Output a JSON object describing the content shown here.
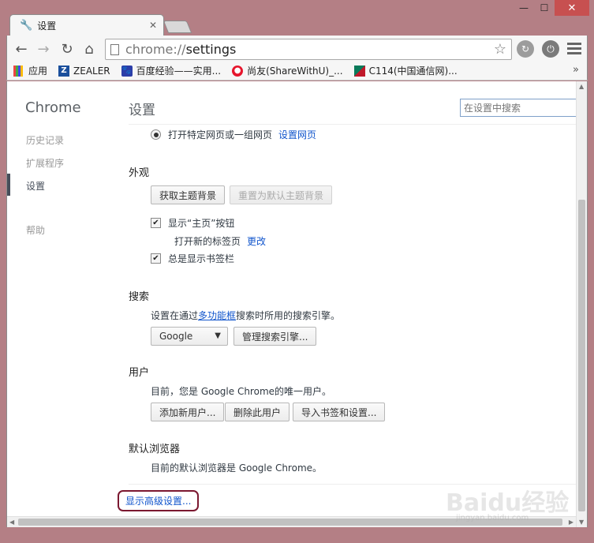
{
  "window": {
    "minimize_glyph": "—",
    "maximize_glyph": "☐",
    "close_glyph": "✕"
  },
  "tab": {
    "title": "设置",
    "icon": "wrench-icon",
    "close_glyph": "✕"
  },
  "toolbar": {
    "back_glyph": "←",
    "forward_glyph": "→",
    "reload_glyph": "↻",
    "home_glyph": "⌂",
    "url_scheme": "chrome://",
    "url_path": "settings",
    "star_glyph": "☆"
  },
  "bookmarks": {
    "items": [
      {
        "label": "应用",
        "icon": "apps-grid-icon"
      },
      {
        "label": "ZEALER",
        "icon": "zealer-icon",
        "icon_text": "Z"
      },
      {
        "label": "百度经验——实用...",
        "icon": "baidu-paw-icon"
      },
      {
        "label": "尚友(ShareWithU)_...",
        "icon": "weibo-icon"
      },
      {
        "label": "C114(中国通信网)...",
        "icon": "c114-icon"
      }
    ],
    "more_glyph": "»"
  },
  "sidebar": {
    "logo": "Chrome",
    "items": [
      {
        "label": "历史记录"
      },
      {
        "label": "扩展程序"
      },
      {
        "label": "设置",
        "selected": true
      },
      {
        "label": "帮助"
      }
    ]
  },
  "header": {
    "title": "设置",
    "search_placeholder": "在设置中搜索"
  },
  "startup": {
    "option_label": "打开特定网页或一组网页",
    "option_link": "设置网页"
  },
  "appearance": {
    "title": "外观",
    "get_themes": "获取主题背景",
    "reset_theme": "重置为默认主题背景",
    "show_home": "显示“主页”按钮",
    "home_desc": "打开新的标签页",
    "home_change": "更改",
    "show_bookmarks": "总是显示书签栏"
  },
  "search": {
    "title": "搜索",
    "desc_prefix": "设置在通过",
    "desc_link": "多功能框",
    "desc_suffix": "搜索时所用的搜索引擎。",
    "engine": "Google",
    "manage": "管理搜索引擎..."
  },
  "users": {
    "title": "用户",
    "desc": "目前，您是 Google Chrome的唯一用户。",
    "add": "添加新用户...",
    "delete": "删除此用户",
    "import": "导入书签和设置..."
  },
  "default_browser": {
    "title": "默认浏览器",
    "desc": "目前的默认浏览器是 Google Chrome。"
  },
  "advanced": {
    "label": "显示高级设置..."
  },
  "watermark": {
    "text": "Baidu经验",
    "sub": "jingyan.baidu.com"
  }
}
